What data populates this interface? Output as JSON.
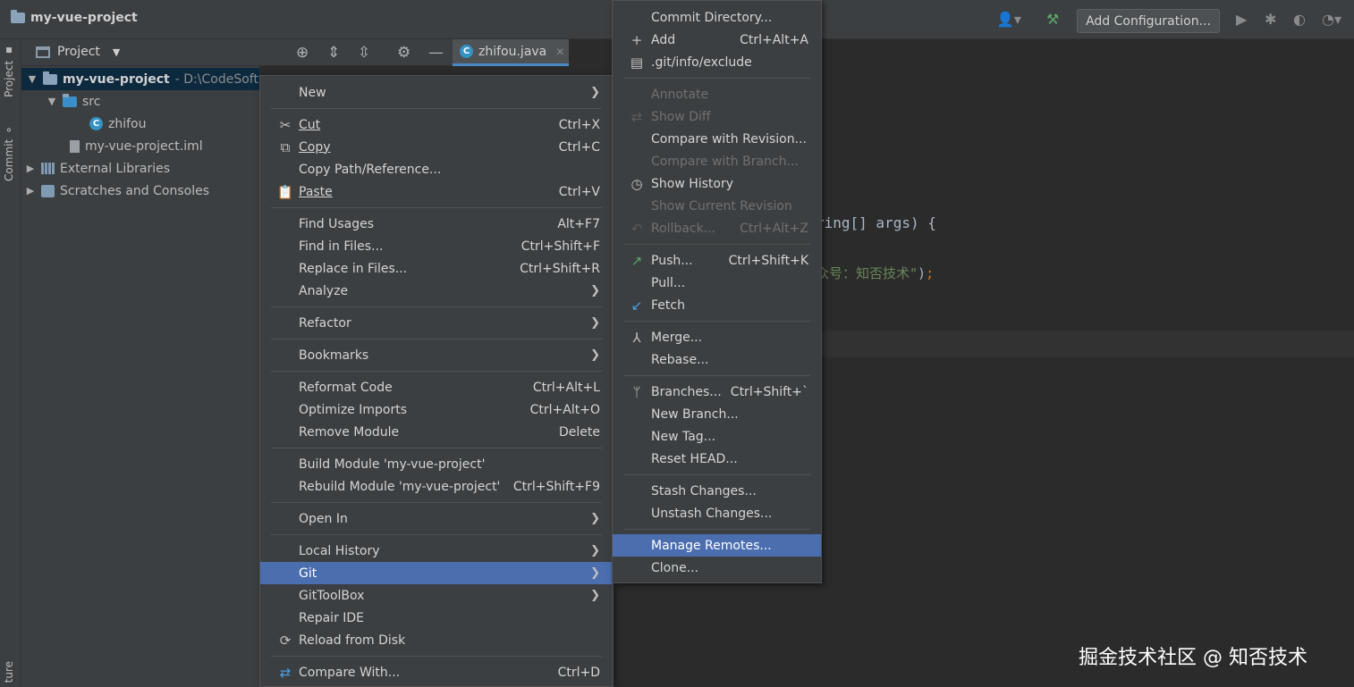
{
  "titlebar": {
    "project_name": "my-vue-project",
    "add_configuration": "Add Configuration..."
  },
  "sidebar": {
    "project_tab": "Project",
    "commit_tab": "Commit",
    "structure_tab": "ture"
  },
  "project_panel": {
    "title": "Project",
    "tree": [
      {
        "label": "my-vue-project",
        "path": "- D:\\CodeSoft"
      },
      {
        "label": "src"
      },
      {
        "label": "zhifou"
      },
      {
        "label": "my-vue-project.iml"
      },
      {
        "label": "External Libraries"
      },
      {
        "label": "Scratches and Consoles"
      }
    ]
  },
  "editor": {
    "tab_label": "zhifou.java",
    "code_line1": "ring[] args) {",
    "code_line2_string": "众号：知否技术\"",
    "code_line2_close": ")",
    "code_line2_semicolon": ";"
  },
  "context_menu": {
    "items": [
      {
        "label": "New",
        "shortcut": ""
      },
      {
        "label": "Cut",
        "shortcut": "Ctrl+X"
      },
      {
        "label": "Copy",
        "shortcut": "Ctrl+C"
      },
      {
        "label": "Copy Path/Reference...",
        "shortcut": ""
      },
      {
        "label": "Paste",
        "shortcut": "Ctrl+V"
      },
      {
        "label": "Find Usages",
        "shortcut": "Alt+F7"
      },
      {
        "label": "Find in Files...",
        "shortcut": "Ctrl+Shift+F"
      },
      {
        "label": "Replace in Files...",
        "shortcut": "Ctrl+Shift+R"
      },
      {
        "label": "Analyze",
        "shortcut": ""
      },
      {
        "label": "Refactor",
        "shortcut": ""
      },
      {
        "label": "Bookmarks",
        "shortcut": ""
      },
      {
        "label": "Reformat Code",
        "shortcut": "Ctrl+Alt+L"
      },
      {
        "label": "Optimize Imports",
        "shortcut": "Ctrl+Alt+O"
      },
      {
        "label": "Remove Module",
        "shortcut": "Delete"
      },
      {
        "label": "Build Module 'my-vue-project'",
        "shortcut": ""
      },
      {
        "label": "Rebuild Module 'my-vue-project'",
        "shortcut": "Ctrl+Shift+F9"
      },
      {
        "label": "Open In",
        "shortcut": ""
      },
      {
        "label": "Local History",
        "shortcut": ""
      },
      {
        "label": "Git",
        "shortcut": ""
      },
      {
        "label": "GitToolBox",
        "shortcut": ""
      },
      {
        "label": "Repair IDE",
        "shortcut": ""
      },
      {
        "label": "Reload from Disk",
        "shortcut": ""
      },
      {
        "label": "Compare With...",
        "shortcut": "Ctrl+D"
      }
    ]
  },
  "git_menu": {
    "items": [
      {
        "label": "Commit Directory...",
        "shortcut": ""
      },
      {
        "label": "Add",
        "shortcut": "Ctrl+Alt+A"
      },
      {
        "label": ".git/info/exclude",
        "shortcut": ""
      },
      {
        "label": "Annotate",
        "shortcut": ""
      },
      {
        "label": "Show Diff",
        "shortcut": ""
      },
      {
        "label": "Compare with Revision...",
        "shortcut": ""
      },
      {
        "label": "Compare with Branch...",
        "shortcut": ""
      },
      {
        "label": "Show History",
        "shortcut": ""
      },
      {
        "label": "Show Current Revision",
        "shortcut": ""
      },
      {
        "label": "Rollback...",
        "shortcut": "Ctrl+Alt+Z"
      },
      {
        "label": "Push...",
        "shortcut": "Ctrl+Shift+K"
      },
      {
        "label": "Pull...",
        "shortcut": ""
      },
      {
        "label": "Fetch",
        "shortcut": ""
      },
      {
        "label": "Merge...",
        "shortcut": ""
      },
      {
        "label": "Rebase...",
        "shortcut": ""
      },
      {
        "label": "Branches...",
        "shortcut": "Ctrl+Shift+`"
      },
      {
        "label": "New Branch...",
        "shortcut": ""
      },
      {
        "label": "New Tag...",
        "shortcut": ""
      },
      {
        "label": "Reset HEAD...",
        "shortcut": ""
      },
      {
        "label": "Stash Changes...",
        "shortcut": ""
      },
      {
        "label": "Unstash Changes...",
        "shortcut": ""
      },
      {
        "label": "Manage Remotes...",
        "shortcut": ""
      },
      {
        "label": "Clone...",
        "shortcut": ""
      }
    ]
  },
  "watermark": "掘金技术社区 @ 知否技术",
  "colors": {
    "selection": "#4b6eaf",
    "menu_bg": "#3c3f41",
    "editor_bg": "#2b2b2b",
    "string": "#6a8759",
    "keyword": "#cc7832"
  }
}
